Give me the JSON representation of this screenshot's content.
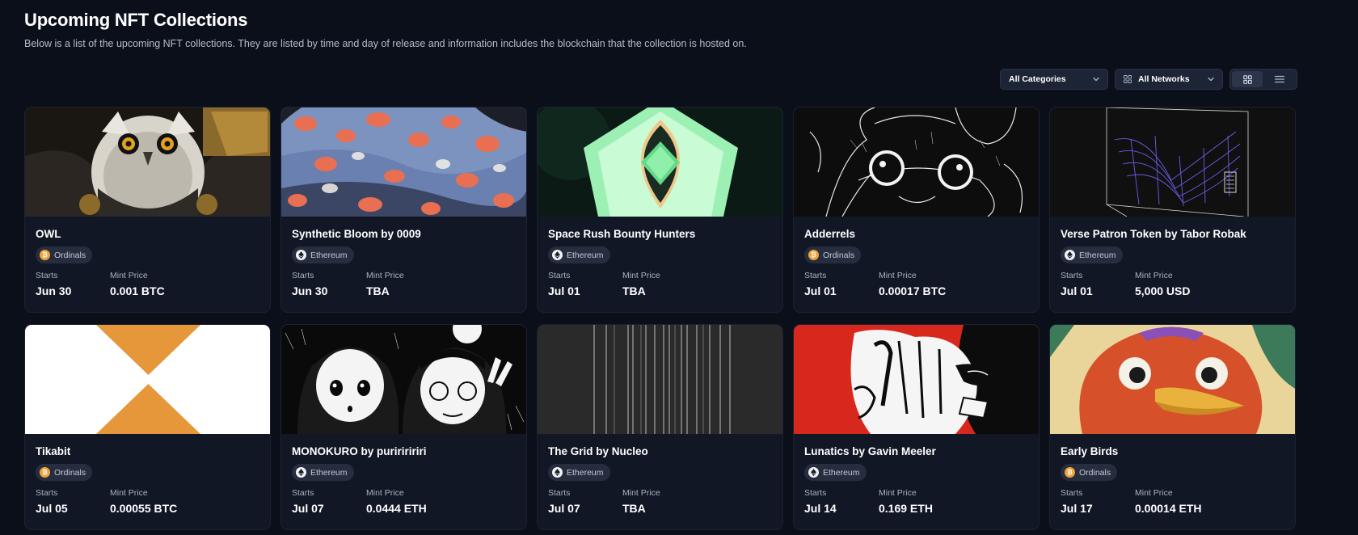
{
  "header": {
    "title": "Upcoming NFT Collections",
    "description": "Below is a list of the upcoming NFT collections. They are listed by time and day of release and information includes the blockchain that the collection is hosted on."
  },
  "filters": {
    "category": "All Categories",
    "network": "All Networks",
    "view_mode": "grid"
  },
  "labels": {
    "starts": "Starts",
    "mint_price": "Mint Price"
  },
  "colors": {
    "background": "#0b0f1a",
    "card": "#121726",
    "badge": "#262d3e",
    "bitcoin": "#f2a33a",
    "ethereum": "#f1f3f6"
  },
  "collections": [
    {
      "name": "OWL",
      "chain": "Ordinals",
      "starts": "Jun 30",
      "mint_price": "0.001 BTC"
    },
    {
      "name": "Synthetic Bloom by 0009",
      "chain": "Ethereum",
      "starts": "Jun 30",
      "mint_price": "TBA"
    },
    {
      "name": "Space Rush Bounty Hunters",
      "chain": "Ethereum",
      "starts": "Jul 01",
      "mint_price": "TBA"
    },
    {
      "name": "Adderrels",
      "chain": "Ordinals",
      "starts": "Jul 01",
      "mint_price": "0.00017 BTC"
    },
    {
      "name": "Verse Patron Token by Tabor Robak",
      "chain": "Ethereum",
      "starts": "Jul 01",
      "mint_price": "5,000 USD"
    },
    {
      "name": "Tikabit",
      "chain": "Ordinals",
      "starts": "Jul 05",
      "mint_price": "0.00055 BTC"
    },
    {
      "name": "MONOKURO by puririririri",
      "chain": "Ethereum",
      "starts": "Jul 07",
      "mint_price": "0.0444 ETH"
    },
    {
      "name": "The Grid by Nucleo",
      "chain": "Ethereum",
      "starts": "Jul 07",
      "mint_price": "TBA"
    },
    {
      "name": "Lunatics by Gavin Meeler",
      "chain": "Ethereum",
      "starts": "Jul 14",
      "mint_price": "0.169 ETH"
    },
    {
      "name": "Early Birds",
      "chain": "Ordinals",
      "starts": "Jul 17",
      "mint_price": "0.00014 ETH"
    }
  ]
}
